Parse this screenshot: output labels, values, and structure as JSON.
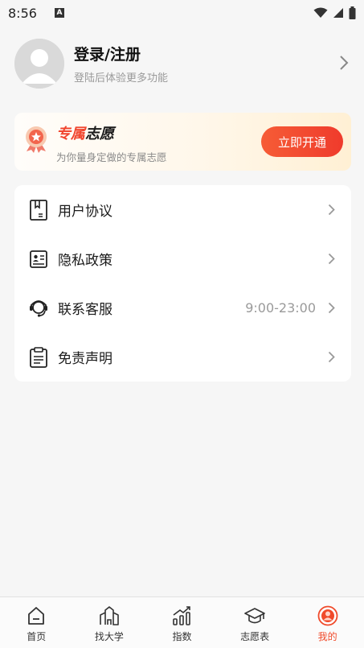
{
  "status_bar": {
    "time": "8:56",
    "a_badge": "A"
  },
  "profile": {
    "title": "登录/注册",
    "subtitle": "登陆后体验更多功能"
  },
  "vip": {
    "title_red": "专属",
    "title_dark": "志愿",
    "subtitle": "为你量身定做的专属志愿",
    "button_label": "立即开通"
  },
  "menu": {
    "items": [
      {
        "label": "用户协议",
        "icon": "document-icon",
        "value": ""
      },
      {
        "label": "隐私政策",
        "icon": "id-card-icon",
        "value": ""
      },
      {
        "label": "联系客服",
        "icon": "headset-icon",
        "value": "9:00-23:00"
      },
      {
        "label": "免责声明",
        "icon": "clipboard-icon",
        "value": ""
      }
    ]
  },
  "tabbar": {
    "tabs": [
      {
        "label": "首页",
        "icon": "home-icon"
      },
      {
        "label": "找大学",
        "icon": "university-icon"
      },
      {
        "label": "指数",
        "icon": "chart-icon"
      },
      {
        "label": "志愿表",
        "icon": "graduation-cap-icon"
      },
      {
        "label": "我的",
        "icon": "profile-icon"
      }
    ],
    "active_index": 4
  },
  "colors": {
    "accent": "#f04a2a",
    "background": "#f6f6f6"
  }
}
